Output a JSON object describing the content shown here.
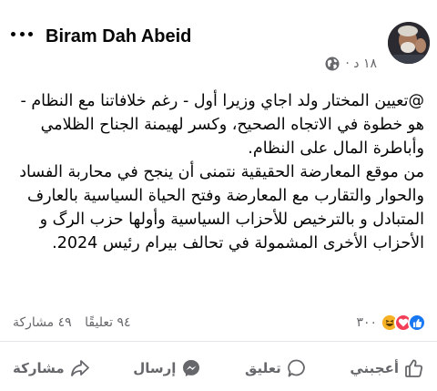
{
  "post": {
    "author": "Biram Dah Abeid",
    "time": "١٨ د ·",
    "paragraphs": [
      "@تعيين المختار ولد اجاي وزيرا أول - رغم خلافاتنا مع النظام - هو خطوة في الاتجاه الصحيح، وكسر لهيمنة الجناح الظلامي وأباطرة المال على النظام.",
      "من موقع المعارضة الحقيقية نتمنى أن ينجح في محاربة الفساد والحوار والتقارب مع المعارضة وفتح الحياة السياسية بالعارف المتبادل و بالترخيص للأحزاب السياسية وأولها حزب الرگ و الأحزاب الأخرى المشمولة في تحالف بيرام رئيس 2024."
    ]
  },
  "reactions": {
    "count": "٣٠٠",
    "types": [
      "like",
      "love",
      "haha"
    ],
    "colors": {
      "like": "#1877f2",
      "love": "#f33e58",
      "haha": "#f7b125"
    }
  },
  "stats": {
    "comments": "٩٤ تعليقًا",
    "shares": "٤٩ مشاركة"
  },
  "actions": {
    "like": "أعجبني",
    "comment": "تعليق",
    "send": "إرسال",
    "share": "مشاركة"
  },
  "icons": {
    "more": "more-horizontal-icon",
    "privacy": "globe-icon",
    "like": "thumbs-up-icon",
    "comment": "comment-bubble-icon",
    "send": "messenger-icon",
    "share": "share-arrow-icon"
  }
}
